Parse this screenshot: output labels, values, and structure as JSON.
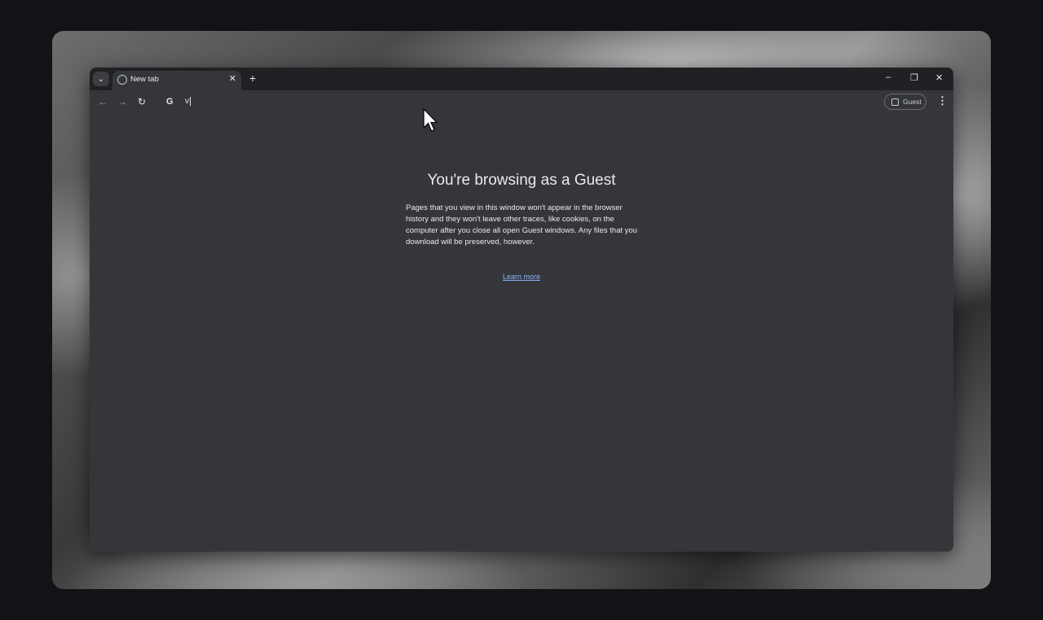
{
  "tab": {
    "title": "New tab",
    "close": "✕"
  },
  "tabstrip": {
    "search_glyph": "⌄",
    "new_tab": "+"
  },
  "window_controls": {
    "minimize": "–",
    "restore": "❐",
    "close": "✕"
  },
  "toolbar": {
    "back": "←",
    "forward": "→",
    "reload": "↻",
    "omnibox_logo": "G",
    "omnibox_value": "v",
    "profile_label": "Guest",
    "menu": "⋮"
  },
  "page": {
    "title": "You're browsing as a Guest",
    "description": "Pages that you view in this window won't appear in the browser history and they won't leave other traces, like cookies, on the computer after you close all open Guest windows. Any files that you download will be preserved, however.",
    "learn_more": "Learn more"
  },
  "icons": {
    "tab_favicon": "globe-icon",
    "profile": "person-badge-icon"
  }
}
